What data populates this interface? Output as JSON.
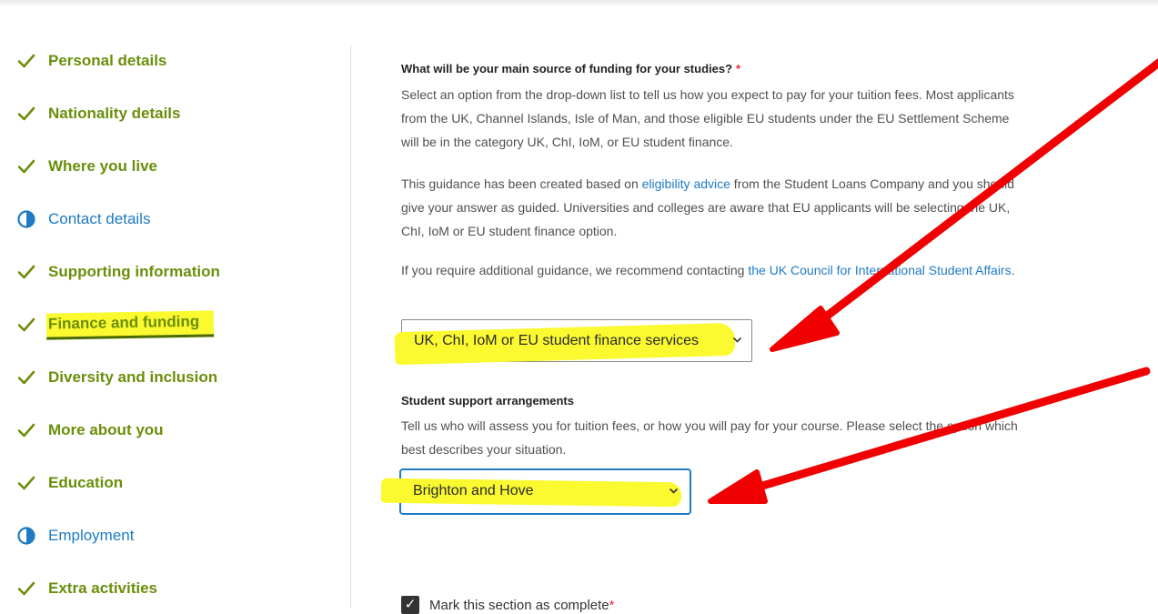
{
  "colors": {
    "done_green": "#6b8e0b",
    "partial_blue": "#1e7bc4",
    "highlight_yellow": "#fbf930",
    "annotation_red": "#f00000",
    "required_red": "#e5283a"
  },
  "sidebar": {
    "items": [
      {
        "label": "Personal details",
        "status": "done",
        "icon": "check-icon"
      },
      {
        "label": "Nationality details",
        "status": "done",
        "icon": "check-icon"
      },
      {
        "label": "Where you live",
        "status": "done",
        "icon": "check-icon"
      },
      {
        "label": "Contact details",
        "status": "partial",
        "icon": "half-circle-icon"
      },
      {
        "label": "Supporting information",
        "status": "done",
        "icon": "check-icon"
      },
      {
        "label": "Finance and funding",
        "status": "done",
        "icon": "check-icon",
        "current": true
      },
      {
        "label": "Diversity and inclusion",
        "status": "done",
        "icon": "check-icon"
      },
      {
        "label": "More about you",
        "status": "done",
        "icon": "check-icon"
      },
      {
        "label": "Education",
        "status": "done",
        "icon": "check-icon"
      },
      {
        "label": "Employment",
        "status": "partial",
        "icon": "half-circle-icon"
      },
      {
        "label": "Extra activities",
        "status": "done",
        "icon": "check-icon"
      }
    ]
  },
  "funding": {
    "title": "What will be your main source of funding for your studies?",
    "required_mark": "*",
    "para1": "Select an option from the drop-down list to tell us how you expect to pay for your tuition fees. Most applicants from the UK, Channel Islands, Isle of Man, and those eligible EU students under the EU Settlement Scheme will be in the category UK, ChI, IoM, or EU student finance.",
    "para2_before": "This guidance has been created based on ",
    "para2_link": "eligibility advice",
    "para2_after": " from the Student Loans Company and you should give your answer as guided. Universities and colleges are aware that EU applicants will be selecting the UK, ChI, IoM or EU student finance option.",
    "para3_before": "If you require additional guidance, we recommend contacting ",
    "para3_link": "the UK Council for International Student Affairs",
    "para3_after": ".",
    "select_value": "UK, ChI, IoM or EU student finance services"
  },
  "support": {
    "title": "Student support arrangements",
    "para": "Tell us who will assess you for tuition fees, or how you will pay for your course. Please select the option which best describes your situation.",
    "select_value": "Brighton and Hove"
  },
  "complete": {
    "label": "Mark this section as complete",
    "required_mark": "*",
    "checked": true
  }
}
